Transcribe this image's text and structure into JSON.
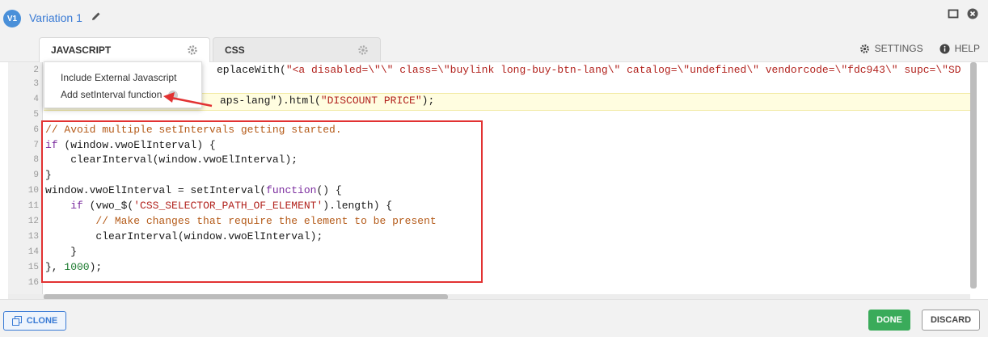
{
  "header": {
    "badge": "V1",
    "variation_name": "Variation 1",
    "icons": [
      "pencil-icon",
      "maximize-icon",
      "close-icon"
    ]
  },
  "tabs": [
    {
      "label": "JAVASCRIPT",
      "active": true,
      "icon": "gear-icon"
    },
    {
      "label": "CSS",
      "active": false,
      "icon": "gear-icon"
    }
  ],
  "toolbar": {
    "settings_label": "SETTINGS",
    "help_label": "HELP"
  },
  "dropdown": {
    "items": [
      "Include External Javascript",
      "Add setInterval function"
    ]
  },
  "editor": {
    "line_numbers": [
      "2",
      "3",
      "4",
      "5",
      "6",
      "7",
      "8",
      "9",
      "10",
      "11",
      "12",
      "13",
      "14",
      "15",
      "16"
    ],
    "line2_fragment": "eplaceWith(",
    "line2_string": "\"<a disabled=\\\"\\\" class=\\\"buylink long-buy-btn-lang\\\" catalog=\\\"undefined\\\" vendorcode=\\\"fdc943\\\" supc=\\\"SD",
    "line4_fragment": "aps-lang\").html(",
    "line4_string": "\"DISCOUNT PRICE\"",
    "line4_end": ");",
    "code": {
      "l6": "// Avoid multiple setIntervals getting started.",
      "l7_kw": "if",
      "l7_rest": " (window.vwoElInterval) {",
      "l8": "    clearInterval(window.vwoElInterval);",
      "l9": "}",
      "l10_a": "window.vwoElInterval = setInterval(",
      "l10_kw": "function",
      "l10_b": "() {",
      "l11_indent": "    ",
      "l11_kw": "if",
      "l11_a": " (vwo_$(",
      "l11_str": "'CSS_SELECTOR_PATH_OF_ELEMENT'",
      "l11_b": ").length) {",
      "l12": "        // Make changes that require the element to be present",
      "l13": "        clearInterval(window.vwoElInterval);",
      "l14": "    }",
      "l15_a": "}, ",
      "l15_num": "1000",
      "l15_b": ");"
    }
  },
  "footer": {
    "clone_label": "CLONE",
    "done_label": "DONE",
    "discard_label": "DISCARD"
  },
  "colors": {
    "accent": "#3a7bd5",
    "done": "#3aab5a",
    "annotation": "#e23232"
  }
}
